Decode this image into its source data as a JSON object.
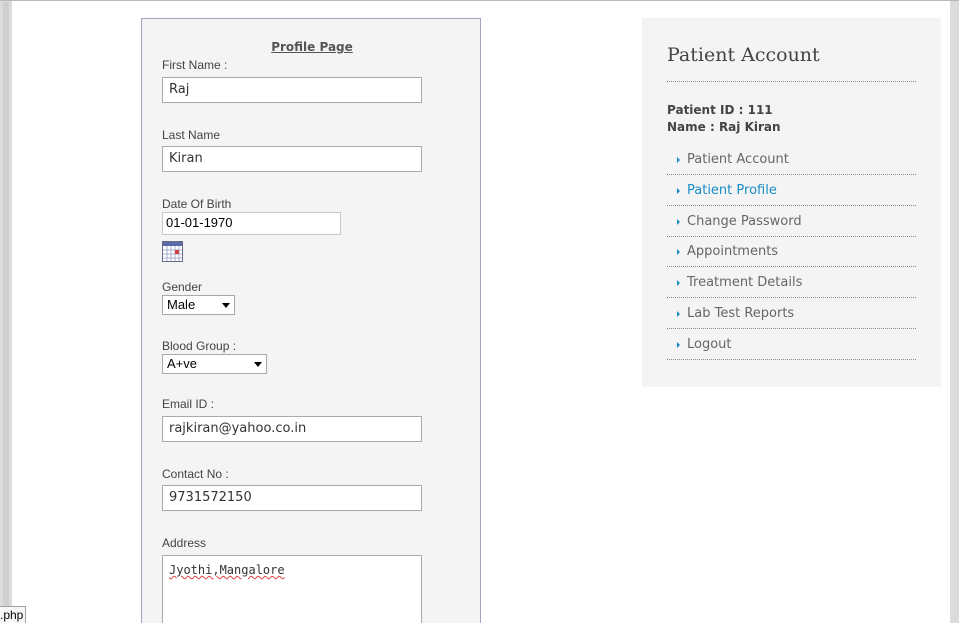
{
  "form": {
    "title": "Profile Page",
    "first_name": {
      "label": "First Name :",
      "value": "Raj"
    },
    "last_name": {
      "label": "Last Name",
      "value": "Kiran"
    },
    "dob": {
      "label": "Date Of Birth",
      "value": "01-01-1970",
      "icon": "calendar-icon"
    },
    "gender": {
      "label": "Gender",
      "value": "Male"
    },
    "blood_group": {
      "label": "Blood Group :",
      "value": "A+ve"
    },
    "email": {
      "label": "Email ID :",
      "value": "rajkiran@yahoo.co.in"
    },
    "contact": {
      "label": "Contact No :",
      "value": "9731572150"
    },
    "address": {
      "label": "Address",
      "value": "Jyothi,Mangalore"
    }
  },
  "sidebar": {
    "title": "Patient Account",
    "patient_id": "Patient ID : 111",
    "patient_name": "Name : Raj Kiran",
    "accent_color": "#1a8cc8",
    "items": [
      {
        "label": "Patient Account",
        "active": false
      },
      {
        "label": "Patient Profile",
        "active": true
      },
      {
        "label": "Change Password",
        "active": false
      },
      {
        "label": "Appointments",
        "active": false
      },
      {
        "label": "Treatment Details",
        "active": false
      },
      {
        "label": "Lab Test Reports",
        "active": false
      },
      {
        "label": "Logout",
        "active": false
      }
    ]
  },
  "status_bar": {
    "text": ".php"
  }
}
